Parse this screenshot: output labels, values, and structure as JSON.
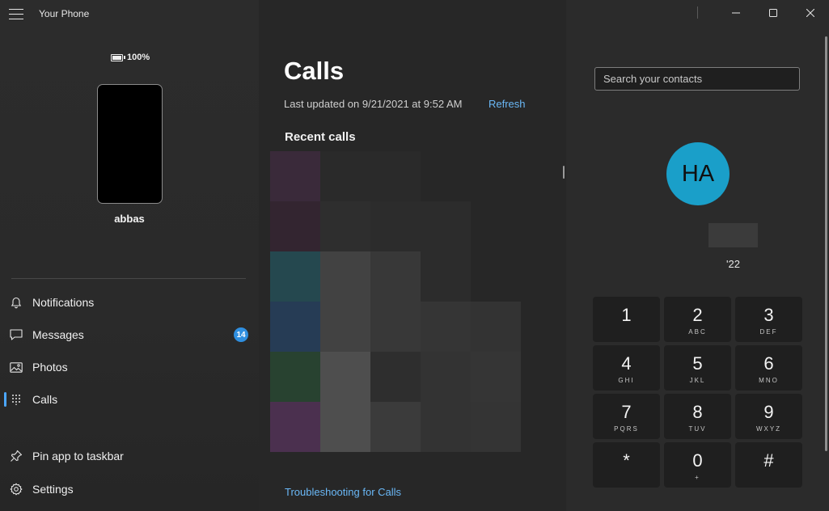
{
  "app": {
    "title": "Your Phone"
  },
  "phone": {
    "battery": "100%",
    "device_name": "abbas"
  },
  "nav": {
    "items": [
      {
        "label": "Notifications",
        "icon": "bell-icon"
      },
      {
        "label": "Messages",
        "icon": "message-icon",
        "badge": "14"
      },
      {
        "label": "Photos",
        "icon": "photos-icon"
      },
      {
        "label": "Calls",
        "icon": "dialpad-icon",
        "active": true
      }
    ],
    "bottom": [
      {
        "label": "Pin app to taskbar",
        "icon": "pin-icon"
      },
      {
        "label": "Settings",
        "icon": "gear-icon"
      }
    ]
  },
  "calls": {
    "title": "Calls",
    "last_updated": "Last updated on 9/21/2021 at 9:52 AM",
    "refresh": "Refresh",
    "recent_title": "Recent calls",
    "troubleshoot": "Troubleshooting for Calls"
  },
  "recent_calls_mosaic": {
    "colors": [
      [
        "#3a2a3a",
        "#2a2a2a",
        "#2a2a2a",
        null,
        null
      ],
      [
        "#332530",
        "#2e2e2e",
        "#2c2c2c",
        "#2c2c2c",
        null
      ],
      [
        "#25484f",
        "#424242",
        "#383838",
        "#2c2c2c",
        null
      ],
      [
        "#263c55",
        "#424242",
        "#383838",
        "#353535",
        "#333333"
      ],
      [
        "#284230",
        "#4e4e4e",
        "#2e2e2e",
        "#333333",
        "#353535"
      ],
      [
        "#4b304f",
        "#4e4e4e",
        "#3b3b3b",
        "#333333",
        "#343434"
      ]
    ]
  },
  "search": {
    "placeholder": "Search your contacts"
  },
  "contact": {
    "initials": "HA",
    "subtitle": "'22"
  },
  "dialpad": {
    "keys": [
      {
        "num": "1",
        "letters": ""
      },
      {
        "num": "2",
        "letters": "ABC"
      },
      {
        "num": "3",
        "letters": "DEF"
      },
      {
        "num": "4",
        "letters": "GHI"
      },
      {
        "num": "5",
        "letters": "JKL"
      },
      {
        "num": "6",
        "letters": "MNO"
      },
      {
        "num": "7",
        "letters": "PQRS"
      },
      {
        "num": "8",
        "letters": "TUV"
      },
      {
        "num": "9",
        "letters": "WXYZ"
      },
      {
        "num": "*",
        "letters": ""
      },
      {
        "num": "0",
        "letters": "+"
      },
      {
        "num": "#",
        "letters": ""
      }
    ]
  },
  "window_controls": [
    {
      "name": "minimize-icon"
    },
    {
      "name": "maximize-icon"
    },
    {
      "name": "close-icon"
    }
  ],
  "colors": {
    "accent": "#4ca7ff",
    "link": "#6ab8f7",
    "badge": "#2f8fe0",
    "avatar": "#1a9fc9"
  }
}
